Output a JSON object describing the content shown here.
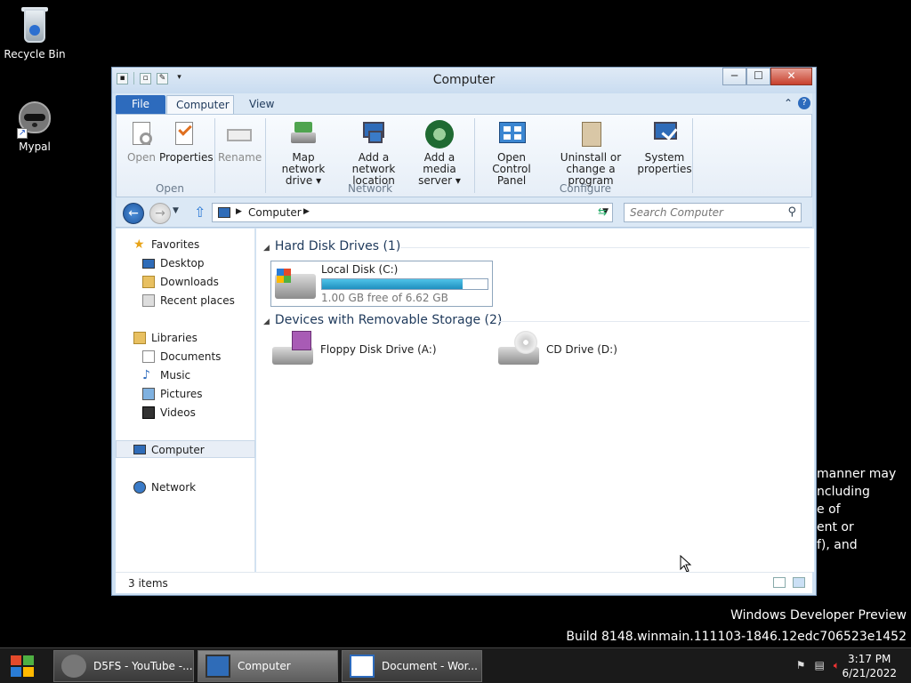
{
  "desktop": {
    "icons": [
      {
        "label": "Recycle Bin",
        "icon": "recycle-bin-icon"
      },
      {
        "label": "Mypal",
        "icon": "raccoon-browser-icon"
      }
    ],
    "watermark_line1": "Windows Developer Preview",
    "watermark_line2": "Build 8148.winmain.111103-1846.12edc706523e1452",
    "background_text": [
      "manner may",
      "ncluding",
      "e of",
      "ent or",
      "f), and"
    ]
  },
  "window": {
    "title": "Computer",
    "quick_access": [
      "properties-icon",
      "new-folder-icon",
      "customize-dropdown-icon"
    ],
    "controls": {
      "minimize": "─",
      "maximize": "☐",
      "close": "✕"
    },
    "tabs": {
      "file": "File",
      "computer": "Computer",
      "view": "View"
    },
    "ribbon": {
      "groups": {
        "open": {
          "label": "Open",
          "buttons": [
            {
              "label": "Open",
              "enabled": false
            },
            {
              "label": "Properties",
              "enabled": true
            },
            {
              "label": "Rename",
              "enabled": false
            }
          ]
        },
        "network": {
          "label": "Network",
          "buttons": [
            {
              "line1": "Map network",
              "line2": "drive ▾"
            },
            {
              "line1": "Add a network",
              "line2": "location"
            },
            {
              "line1": "Add a media",
              "line2": "server ▾"
            }
          ]
        },
        "configure": {
          "label": "Configure",
          "buttons": [
            {
              "line1": "Open Control",
              "line2": "Panel"
            },
            {
              "line1": "Uninstall or",
              "line2": "change a program"
            },
            {
              "line1": "System",
              "line2": "properties"
            }
          ]
        }
      }
    },
    "address": {
      "crumb": "Computer",
      "search_placeholder": "Search Computer"
    },
    "nav_pane": {
      "favorites": {
        "label": "Favorites",
        "items": [
          "Desktop",
          "Downloads",
          "Recent places"
        ]
      },
      "libraries": {
        "label": "Libraries",
        "items": [
          "Documents",
          "Music",
          "Pictures",
          "Videos"
        ]
      },
      "computer": "Computer",
      "network": "Network"
    },
    "content": {
      "hard_disk_group": "Hard Disk Drives (1)",
      "local_disk": {
        "name": "Local Disk (C:)",
        "free_text": "1.00 GB free of 6.62 GB",
        "used_fraction": 0.85
      },
      "removable_group": "Devices with Removable Storage (2)",
      "floppy": "Floppy Disk Drive (A:)",
      "cd": "CD Drive (D:)"
    },
    "status": {
      "items": "3 items"
    }
  },
  "taskbar": {
    "buttons": [
      {
        "label": "D5FS - YouTube -...",
        "icon": "raccoon-browser-icon"
      },
      {
        "label": "Computer",
        "icon": "computer-icon"
      },
      {
        "label": "Document - Wor...",
        "icon": "wordpad-icon"
      }
    ],
    "time": "3:17 PM",
    "date": "6/21/2022"
  }
}
